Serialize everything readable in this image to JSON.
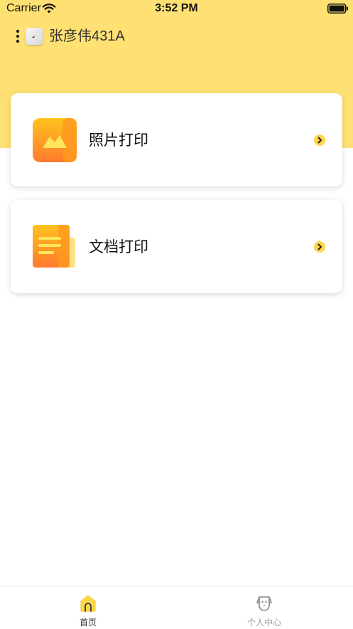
{
  "status_bar": {
    "carrier": "Carrier",
    "time": "3:52 PM"
  },
  "top_bar": {
    "device_name": "张彦伟431A"
  },
  "cards": [
    {
      "label": "照片打印",
      "icon": "photo-print-icon"
    },
    {
      "label": "文档打印",
      "icon": "document-print-icon"
    }
  ],
  "tab_bar": {
    "items": [
      {
        "label": "首页",
        "icon": "home-icon",
        "active": true
      },
      {
        "label": "个人中心",
        "icon": "dog-face-icon",
        "active": false
      }
    ]
  },
  "colors": {
    "header_background": "#FFE173",
    "accent": "#FFD54A",
    "icon_orange": "#FF8A2A",
    "inactive_tab": "#999999"
  }
}
